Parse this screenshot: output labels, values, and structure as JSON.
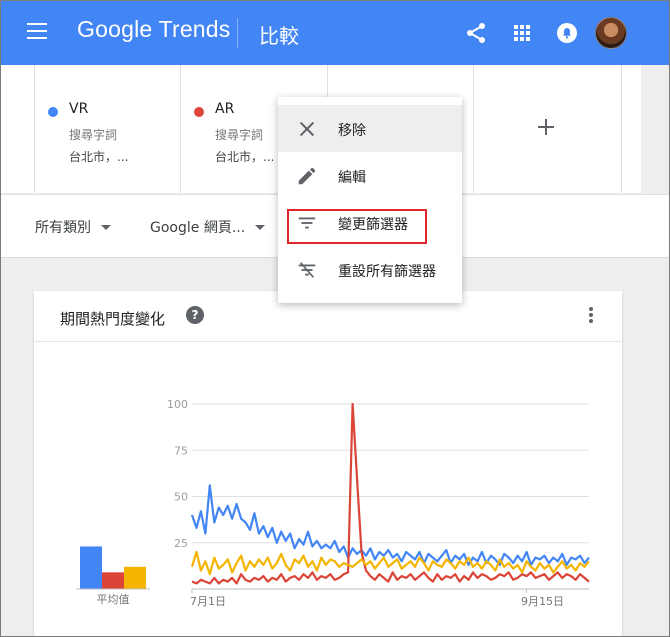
{
  "header": {
    "brand_google": "Google",
    "brand_trends": "Trends",
    "page_title": "比較"
  },
  "terms": [
    {
      "name": "VR",
      "type": "搜尋字詞",
      "location": "台北市，...",
      "color": "#4285f4"
    },
    {
      "name": "AR",
      "type": "搜尋字詞",
      "location": "台北市，...",
      "color": "#db4437"
    }
  ],
  "filters": {
    "category": "所有類別",
    "property": "Google 網頁..."
  },
  "menu": {
    "items": [
      {
        "label": "移除",
        "icon": "close-icon"
      },
      {
        "label": "編輯",
        "icon": "pencil-icon"
      },
      {
        "label": "變更篩選器",
        "icon": "filter-icon"
      },
      {
        "label": "重設所有篩選器",
        "icon": "filter-clear-icon"
      }
    ]
  },
  "card": {
    "title": "期間熱門度變化",
    "help": "?"
  },
  "chart_data": {
    "type": "line",
    "title": "期間熱門度變化",
    "y_ticks": [
      100,
      75,
      50,
      25
    ],
    "ylim": [
      0,
      100
    ],
    "x_tick_labels": [
      "7月1日",
      "9月15日"
    ],
    "x_tick_index": [
      0,
      75
    ],
    "average_label": "平均值",
    "averages": [
      {
        "color": "#4285f4",
        "value": 23
      },
      {
        "color": "#db4437",
        "value": 9
      },
      {
        "color": "#f4b400",
        "value": 12
      }
    ],
    "series": [
      {
        "color": "#4285f4",
        "values": [
          40,
          33,
          42,
          30,
          56,
          36,
          44,
          40,
          45,
          38,
          46,
          38,
          36,
          32,
          41,
          30,
          34,
          28,
          33,
          25,
          31,
          26,
          30,
          22,
          27,
          24,
          31,
          23,
          26,
          22,
          24,
          22,
          26,
          20,
          23,
          17,
          22,
          19,
          21,
          18,
          22,
          16,
          20,
          18,
          21,
          17,
          19,
          15,
          20,
          18,
          16,
          20,
          14,
          19,
          17,
          15,
          18,
          21,
          14,
          18,
          16,
          19,
          13,
          17,
          15,
          20,
          14,
          18,
          16,
          13,
          19,
          17,
          14,
          18,
          15,
          20,
          13,
          17,
          16,
          18,
          14,
          17,
          15,
          19,
          13,
          17,
          16,
          18,
          14,
          17
        ]
      },
      {
        "color": "#db4437",
        "values": [
          4,
          3,
          5,
          4,
          3,
          6,
          3,
          5,
          4,
          6,
          3,
          8,
          5,
          4,
          6,
          5,
          7,
          4,
          6,
          5,
          8,
          4,
          6,
          7,
          5,
          8,
          6,
          9,
          5,
          7,
          6,
          8,
          5,
          6,
          8,
          9,
          100,
          60,
          20,
          10,
          7,
          5,
          8,
          6,
          4,
          9,
          5,
          7,
          6,
          8,
          5,
          7,
          9,
          6,
          4,
          8,
          5,
          7,
          6,
          8,
          4,
          7,
          5,
          9,
          6,
          8,
          7,
          5,
          6,
          8,
          7,
          9,
          5,
          6,
          8,
          7,
          9,
          6,
          7,
          8,
          5,
          7,
          9,
          6,
          8,
          7,
          5,
          8,
          6,
          4
        ]
      },
      {
        "color": "#f4b400",
        "values": [
          12,
          20,
          10,
          15,
          8,
          17,
          11,
          13,
          16,
          9,
          14,
          18,
          10,
          15,
          12,
          16,
          13,
          17,
          11,
          14,
          19,
          13,
          10,
          16,
          14,
          18,
          12,
          15,
          10,
          17,
          13,
          16,
          15,
          12,
          14,
          13,
          12,
          14,
          16,
          13,
          15,
          11,
          14,
          17,
          12,
          14,
          16,
          11,
          13,
          15,
          12,
          17,
          14,
          10,
          15,
          13,
          12,
          16,
          14,
          11,
          15,
          13,
          17,
          12,
          14,
          11,
          15,
          13,
          10,
          16,
          12,
          14,
          11,
          13,
          9,
          15,
          12,
          10,
          14,
          11,
          13,
          9,
          12,
          15,
          11,
          13,
          10,
          14,
          12,
          15
        ]
      }
    ]
  }
}
